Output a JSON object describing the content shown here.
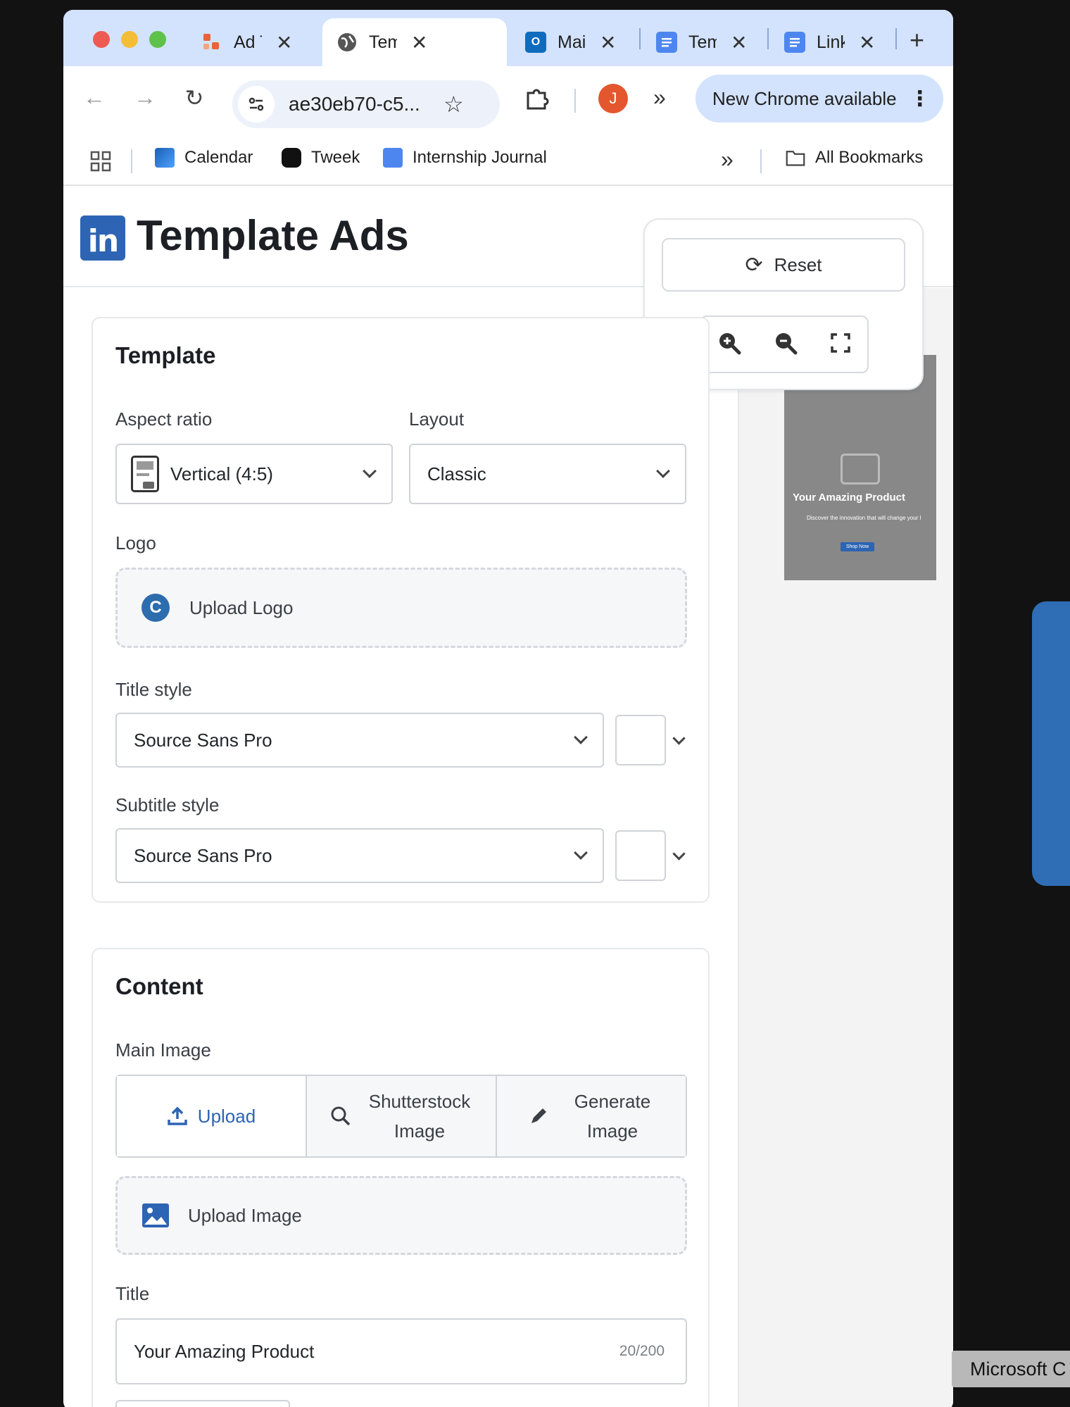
{
  "browser": {
    "tabs": [
      {
        "label": "Ad Templates",
        "active": false
      },
      {
        "label": "Template Ads",
        "active": true
      },
      {
        "label": "Mail",
        "active": false
      },
      {
        "label": "Template",
        "active": false
      },
      {
        "label": "LinkedIn",
        "active": false
      }
    ],
    "new_tab_label": "+",
    "url": "ae30eb70-c5...",
    "avatar_initial": "J",
    "update_label": "New Chrome available",
    "bookmarks": [
      "Calendar",
      "Tweek",
      "Internship Journal"
    ],
    "all_bookmarks_label": "All Bookmarks"
  },
  "page": {
    "title": "Template Ads",
    "brand_color": "#2d64b3"
  },
  "toolbox": {
    "reset_label": "Reset"
  },
  "preview": {
    "title": "Your Amazing Product",
    "subtitle": "Discover the innovation that will change your l",
    "button": "Shop Now"
  },
  "template_card": {
    "heading": "Template",
    "aspect_label": "Aspect ratio",
    "aspect_value": "Vertical (4:5)",
    "layout_label": "Layout",
    "layout_value": "Classic",
    "logo_label": "Logo",
    "logo_upload": "Upload Logo",
    "title_style_label": "Title style",
    "title_font": "Source Sans Pro",
    "subtitle_style_label": "Subtitle style",
    "subtitle_font": "Source Sans Pro"
  },
  "content_card": {
    "heading": "Content",
    "main_image_label": "Main Image",
    "tabs": [
      "Upload",
      "Shutterstock Image",
      "Generate Image"
    ],
    "upload_image": "Upload Image",
    "title_label": "Title",
    "title_value": "Your Amazing Product",
    "title_counter": "20/200"
  },
  "tooltip": "Microsoft C"
}
